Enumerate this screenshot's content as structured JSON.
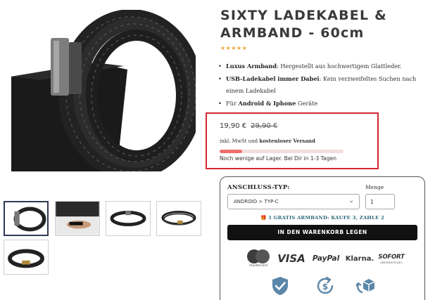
{
  "product": {
    "title": "SIXTY LADEKABEL & ARMBAND - 60cm",
    "rating": "★★★★★",
    "features": [
      {
        "bold": "Luxus Armband",
        "text": ": Hergestellt aus hochwertigem Glattleder."
      },
      {
        "bold": "USB-Ladekabel immer Dabei",
        "text": ": Kein verzweifeltes Suchen nach einem Ladekabel"
      },
      {
        "prefix": "Für ",
        "bold": "Android & Iphone",
        "text": " Geräte"
      }
    ]
  },
  "price": {
    "current": "19,90 €",
    "old": "29,90 €",
    "tax_prefix": "inkl. MwSt und ",
    "tax_bold": "kostenloser Versand",
    "stock_level_fraction": 0.18,
    "stock_text": "Noch wenige auf Lager. Bei Dir in 1-3 Tagen"
  },
  "purchase": {
    "connection_label": "ANSCHLUSS-TYP:",
    "connection_value": "ANDROID > TYP-C",
    "quantity_label": "Menge",
    "quantity_value": "1",
    "promo": "🎁 1 GRATIS ARMBAND: KAUFE 3, ZAHLE 2",
    "cart_button": "IN DEN WARENKORB LEGEN"
  },
  "payments": {
    "mastercard": "mastercard",
    "visa": "VISA",
    "paypal": "PayPal",
    "klarna": "Klarna.",
    "sofort": "SOFORT",
    "sofort_sub": "ÜBERWEISUNG"
  },
  "colors": {
    "highlight_border": "#d3262e",
    "stock_fill": "#ee6e6e",
    "promo_text": "#2b6a7b",
    "cart_button_bg": "#111111",
    "trust_icons": "#5a86a8"
  },
  "icons": [
    "chevron-down-icon",
    "gift-icon",
    "shield-check-icon",
    "money-back-icon",
    "package-return-icon"
  ]
}
